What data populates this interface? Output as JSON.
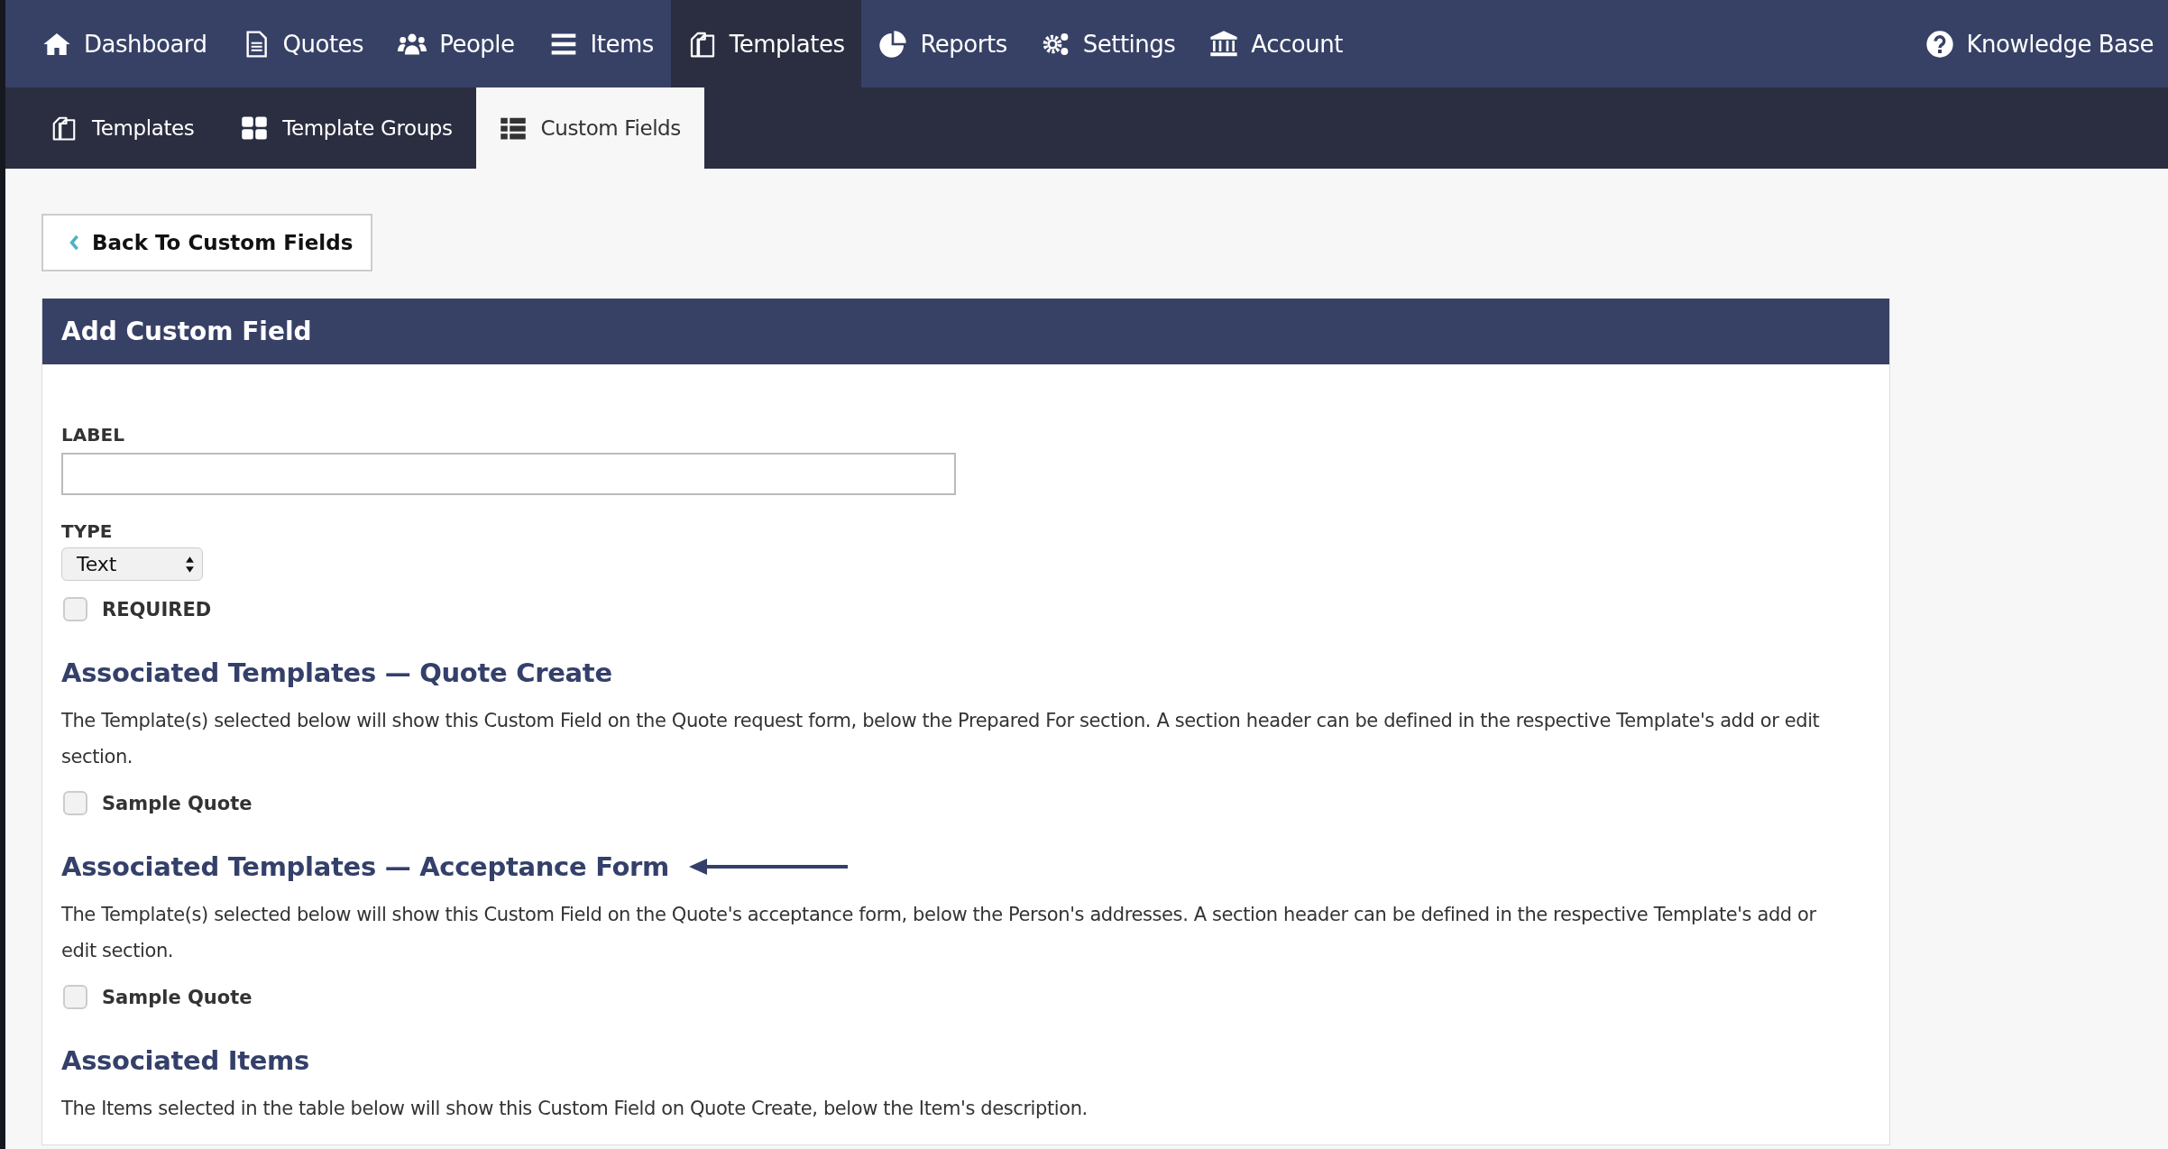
{
  "nav": {
    "items": [
      {
        "label": "Dashboard",
        "kind": "home",
        "selected": false
      },
      {
        "label": "Quotes",
        "kind": "document",
        "selected": false
      },
      {
        "label": "People",
        "kind": "people",
        "selected": false
      },
      {
        "label": "Items",
        "kind": "list",
        "selected": false
      },
      {
        "label": "Templates",
        "kind": "copy",
        "selected": true
      },
      {
        "label": "Reports",
        "kind": "pie",
        "selected": false
      },
      {
        "label": "Settings",
        "kind": "gears",
        "selected": false
      },
      {
        "label": "Account",
        "kind": "bank",
        "selected": false
      }
    ],
    "right": {
      "label": "Knowledge Base",
      "kind": "help"
    }
  },
  "subnav": {
    "items": [
      {
        "label": "Templates",
        "kind": "copy",
        "selected": false
      },
      {
        "label": "Template Groups",
        "kind": "grid",
        "selected": false
      },
      {
        "label": "Custom Fields",
        "kind": "table",
        "selected": true
      }
    ]
  },
  "back_button": "Back To Custom Fields",
  "card": {
    "title": "Add Custom Field",
    "label_field": {
      "label": "LABEL"
    },
    "type_field": {
      "label": "TYPE",
      "value": "Text"
    },
    "required": {
      "label": "REQUIRED",
      "checked": false
    },
    "sections": [
      {
        "title": "Associated Templates — Quote Create",
        "arrow": false,
        "description": "The Template(s) selected below will show this Custom Field on the Quote request form, below the Prepared For section. A section header can be defined in the respective Template's add or edit section.",
        "options": [
          {
            "label": "Sample Quote",
            "checked": false
          }
        ]
      },
      {
        "title": "Associated Templates — Acceptance Form",
        "arrow": true,
        "description": "The Template(s) selected below will show this Custom Field on the Quote's acceptance form, below the Person's addresses. A section header can be defined in the respective Template's add or edit section.",
        "options": [
          {
            "label": "Sample Quote",
            "checked": false
          }
        ]
      },
      {
        "title": "Associated Items",
        "arrow": false,
        "description": "The Items selected in the table below will show this Custom Field on Quote Create, below the Item's description."
      }
    ]
  }
}
